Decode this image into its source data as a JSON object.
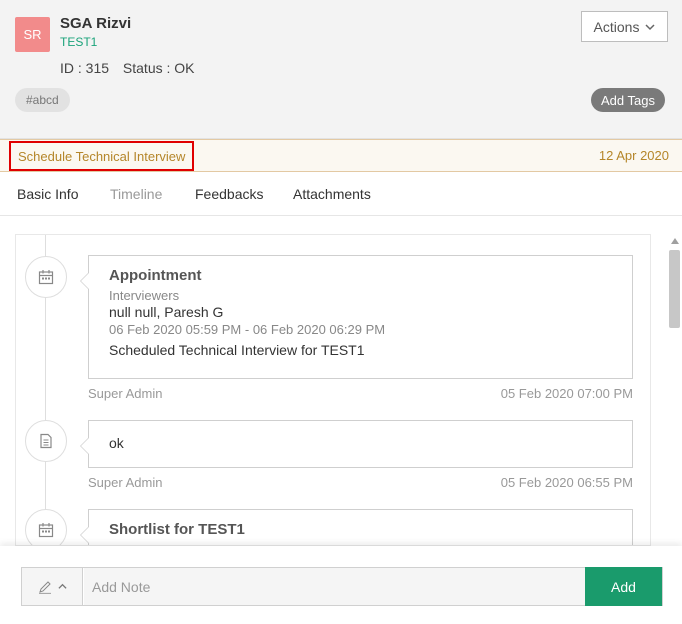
{
  "candidate": {
    "initials": "SR",
    "name": "SGA Rizvi",
    "subtitle": "TEST1",
    "id_text": "ID : 315",
    "status_text": "Status : OK",
    "tag": "#abcd"
  },
  "header": {
    "actions_label": "Actions",
    "add_tags_label": "Add Tags"
  },
  "stage": {
    "name": "Schedule Technical Interview",
    "date": "12 Apr 2020"
  },
  "tabs": [
    {
      "label": "Basic Info"
    },
    {
      "label": "Timeline"
    },
    {
      "label": "Feedbacks"
    },
    {
      "label": "Attachments"
    }
  ],
  "timeline": [
    {
      "icon": "calendar-icon",
      "title": "Appointment",
      "interviewers_label": "Interviewers",
      "interviewers": "null null,  Paresh G",
      "time_range": "06 Feb 2020 05:59 PM - 06 Feb 2020 06:29 PM",
      "description": "Scheduled Technical Interview for TEST1",
      "author": "Super Admin",
      "timestamp": "05 Feb 2020 07:00 PM"
    },
    {
      "icon": "document-icon",
      "text": "ok",
      "author": "Super Admin",
      "timestamp": "05 Feb 2020 06:55 PM"
    },
    {
      "icon": "calendar-icon",
      "title": "Shortlist for TEST1"
    }
  ],
  "note": {
    "placeholder": "Add Note",
    "add_label": "Add"
  },
  "colors": {
    "accent_green": "#1a9b6c",
    "stage_text": "#b5862a",
    "avatar_bg": "#f28b8b",
    "highlight_red": "#e00000"
  }
}
